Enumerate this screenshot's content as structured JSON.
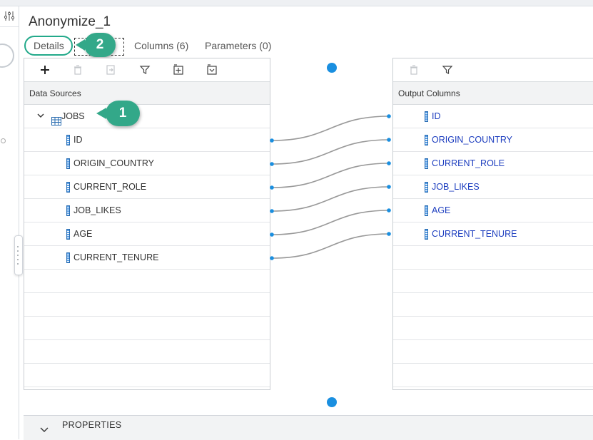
{
  "header": {
    "title": "Anonymize_1",
    "tabs": [
      {
        "label": "Details"
      },
      {
        "label": "Columns (6)"
      },
      {
        "label": "Parameters (0)"
      }
    ]
  },
  "callouts": {
    "first": "1",
    "second": "2"
  },
  "source_panel": {
    "header": "Data Sources",
    "table_name": "JOBS",
    "columns": [
      "ID",
      "ORIGIN_COUNTRY",
      "CURRENT_ROLE",
      "JOB_LIKES",
      "AGE",
      "CURRENT_TENURE"
    ]
  },
  "output_panel": {
    "header": "Output Columns",
    "columns": [
      "ID",
      "ORIGIN_COUNTRY",
      "CURRENT_ROLE",
      "JOB_LIKES",
      "AGE",
      "CURRENT_TENURE"
    ]
  },
  "properties": {
    "label": "PROPERTIES"
  },
  "colors": {
    "callout": "#33a889",
    "connector": "#1a8fe0",
    "output_text": "#1c3dbf",
    "mapping_line": "#999999"
  }
}
